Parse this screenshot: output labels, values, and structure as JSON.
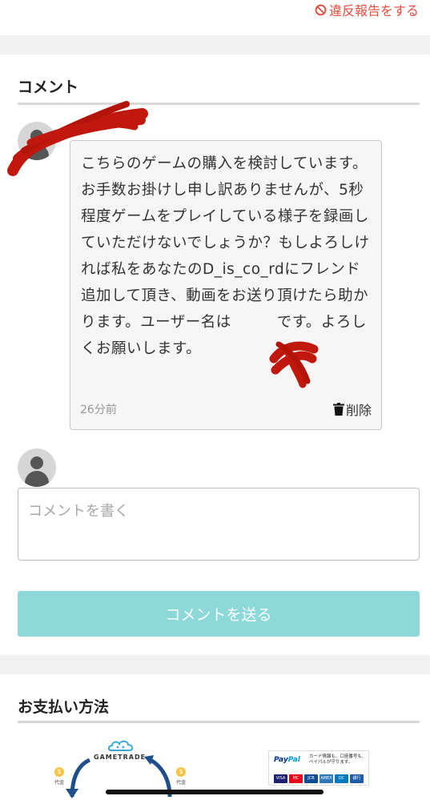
{
  "report_link": {
    "label": "違反報告をする"
  },
  "comments_section": {
    "title": "コメント"
  },
  "comment": {
    "text": "こちらのゲームの購入を検討しています。お手数お掛けし申し訳ありませんが、5秒程度ゲームをプレイしている様子を録画していただけないでしょうか？もしよろしければ私をあなたのD_is_co_rdにフレンド追加して頂き、動画をお送り頂けたら助かります。ユーザー名は　　　です。よろしくお願いします。",
    "time": "26分前",
    "delete_label": "削除"
  },
  "comment_form": {
    "placeholder": "コメントを書く",
    "send_label": "コメントを送る"
  },
  "payment_section": {
    "title": "お支払い方法",
    "gametrade_label": "GAMETRADE",
    "coin_label": "代金",
    "paypal_brand_1": "Pay",
    "paypal_brand_2": "Pal",
    "paypal_note": "カード情報も、口座番号も、ペイパルが守ります。",
    "cards": [
      "VISA",
      "MC",
      "JCB",
      "AMEX",
      "DC",
      "銀行"
    ]
  },
  "colors": {
    "accent_teal": "#8dd9d9",
    "report_red": "#e74c3c",
    "redaction_red": "#c0180c"
  }
}
